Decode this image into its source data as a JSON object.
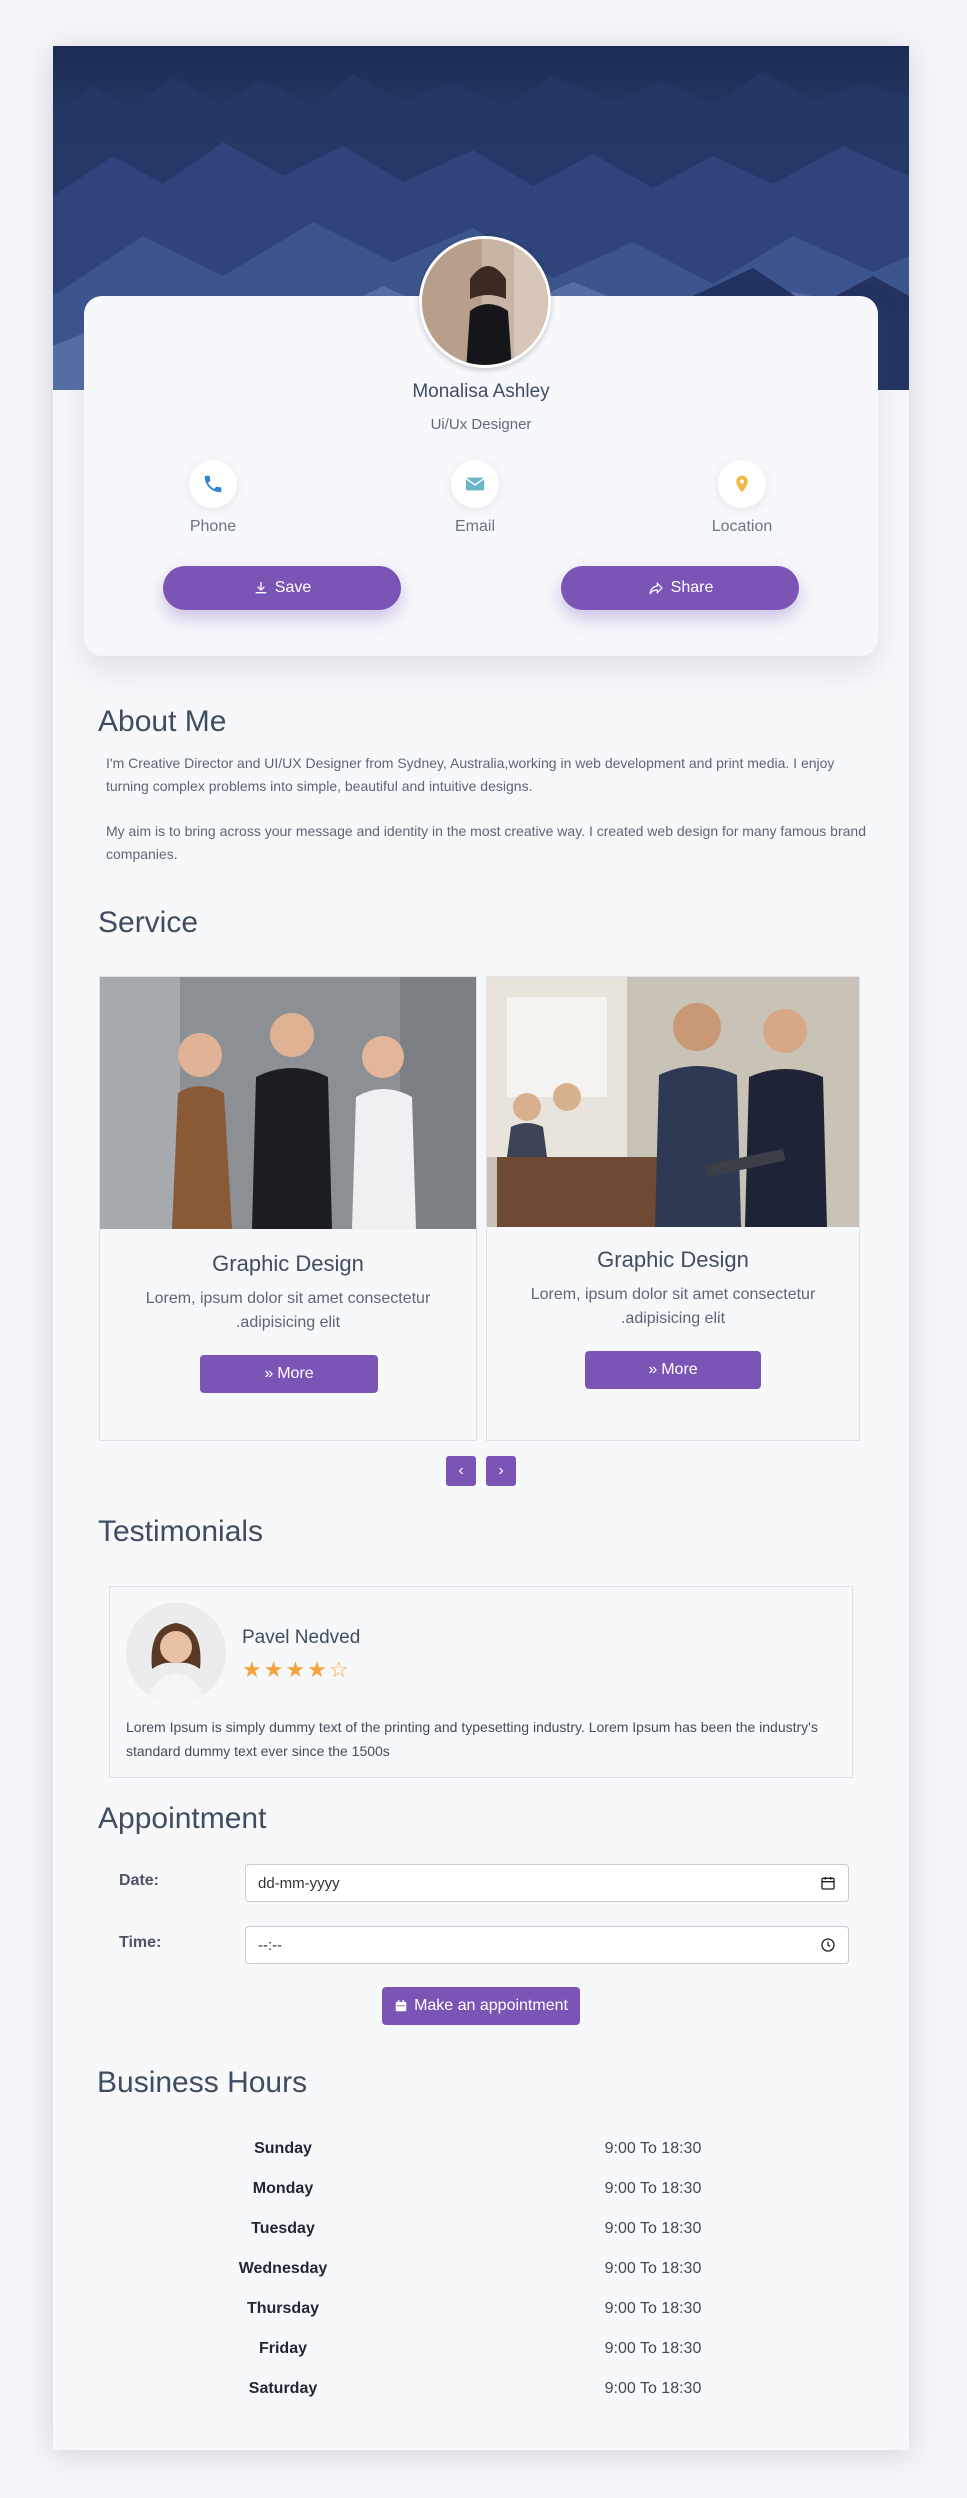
{
  "profile": {
    "name": "Monalisa Ashley",
    "role": "Ui/Ux Designer"
  },
  "contacts": [
    {
      "label": "Phone",
      "icon": "phone-icon",
      "color": "#2f86d8"
    },
    {
      "label": "Email",
      "icon": "envelope-icon",
      "color": "#6ab6c9"
    },
    {
      "label": "Location",
      "icon": "map-pin-icon",
      "color": "#f2b94a"
    }
  ],
  "actions": {
    "save": "Save",
    "share": "Share"
  },
  "about": {
    "title": "About Me",
    "p1": "I'm Creative Director and UI/UX Designer from Sydney, Australia,working in web development and print media. I enjoy turning complex problems into simple, beautiful and intuitive designs.",
    "p2": "My aim is to bring across your message and identity in the most creative way. I created web design for many famous brand companies."
  },
  "services": {
    "title": "Service",
    "items": [
      {
        "title": "Graphic Design",
        "desc": "Lorem, ipsum dolor sit amet consectetur .adipisicing elit",
        "button": "More"
      },
      {
        "title": "Graphic Design",
        "desc": "Lorem, ipsum dolor sit amet consectetur .adipisicing elit",
        "button": "More"
      }
    ],
    "prev": "‹",
    "next": "›"
  },
  "testimonials": {
    "title": "Testimonials",
    "name": "Pavel Nedved",
    "stars": "★★★★☆",
    "rating": 4,
    "text": "Lorem Ipsum is simply dummy text of the printing and typesetting industry. Lorem Ipsum has been the industry's standard dummy text ever since the 1500s"
  },
  "appointment": {
    "title": "Appointment",
    "date_label": "Date:",
    "date_value": "dd-mm-yyyy",
    "time_label": "Time:",
    "time_value": "--:--",
    "button": "Make an appointment"
  },
  "business_hours": {
    "title": "Business Hours",
    "rows": [
      {
        "day": "Sunday",
        "time": "9:00 To 18:30"
      },
      {
        "day": "Monday",
        "time": "9:00 To 18:30"
      },
      {
        "day": "Tuesday",
        "time": "9:00 To 18:30"
      },
      {
        "day": "Wednesday",
        "time": "9:00 To 18:30"
      },
      {
        "day": "Thursday",
        "time": "9:00 To 18:30"
      },
      {
        "day": "Friday",
        "time": "9:00 To 18:30"
      },
      {
        "day": "Saturday",
        "time": "9:00 To 18:30"
      }
    ]
  },
  "colors": {
    "accent": "#7b55b6",
    "star": "#f4a43a",
    "heading": "#3f4d60"
  }
}
